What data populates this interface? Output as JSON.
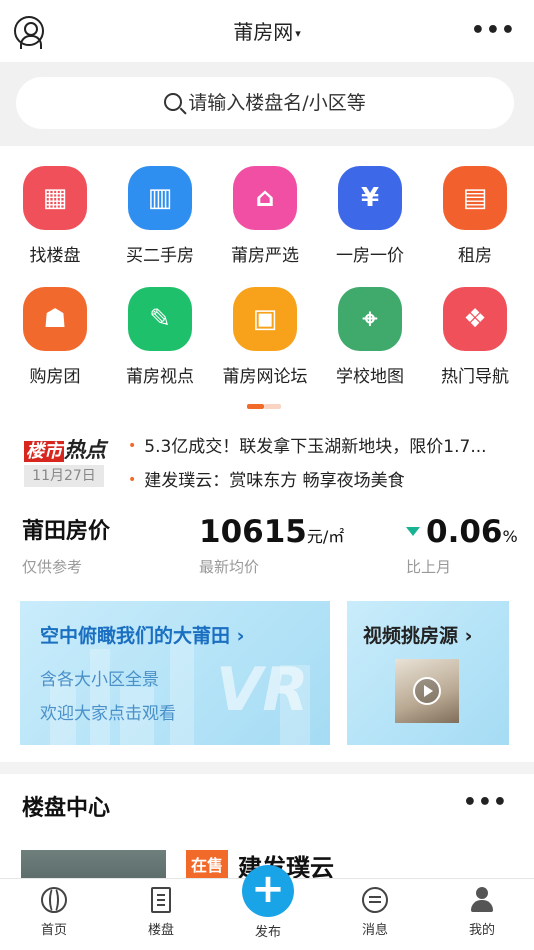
{
  "header": {
    "title": "莆房网",
    "caret": "▾",
    "more": "•••"
  },
  "search": {
    "placeholder": "请输入楼盘名/小区等"
  },
  "grid": {
    "row1": [
      {
        "label": "找楼盘",
        "glyph": "▦",
        "color": "#f0505a"
      },
      {
        "label": "买二手房",
        "glyph": "▥",
        "color": "#2e8ff0"
      },
      {
        "label": "莆房严选",
        "glyph": "⌂",
        "color": "#f04fa4"
      },
      {
        "label": "一房一价",
        "glyph": "¥",
        "color": "#3d68e8"
      },
      {
        "label": "租房",
        "glyph": "▤",
        "color": "#f2602e"
      }
    ],
    "row2": [
      {
        "label": "购房团",
        "glyph": "☗",
        "color": "#f2692e"
      },
      {
        "label": "莆房视点",
        "glyph": "✎",
        "color": "#1fc06b"
      },
      {
        "label": "莆房网论坛",
        "glyph": "▣",
        "color": "#f7a21a"
      },
      {
        "label": "学校地图",
        "glyph": "⌖",
        "color": "#3faa6b"
      },
      {
        "label": "热门导航",
        "glyph": "❖",
        "color": "#f0505a"
      }
    ]
  },
  "news": {
    "logo_a": "楼市",
    "logo_b": "热点",
    "date": "11月27日",
    "items": [
      "5.3亿成交！联发拿下玉湖新地块，限价1.7...",
      "建发璞云：赏味东方 畅享夜场美食"
    ]
  },
  "price": {
    "title": "莆田房价",
    "title_sub": "仅供参考",
    "avg_value": "10615",
    "avg_unit": "元/㎡",
    "avg_sub": "最新均价",
    "change_value": "0.06",
    "change_unit": "%",
    "change_sub": "比上月",
    "down_color": "#19b394"
  },
  "banners": {
    "vr_title": "空中俯瞰我们的大莆田 ›",
    "vr_line1": "含各大小区全景",
    "vr_line2": "欢迎大家点击观看",
    "vr_mark": "VR",
    "video_title": "视频挑房源 ›"
  },
  "center": {
    "title": "楼盘中心",
    "more": "•••"
  },
  "listing": {
    "badge": "在售",
    "name": "建发璞云"
  },
  "tabbar": {
    "home": "首页",
    "listings": "楼盘",
    "publish": "发布",
    "messages": "消息",
    "mine": "我的"
  }
}
